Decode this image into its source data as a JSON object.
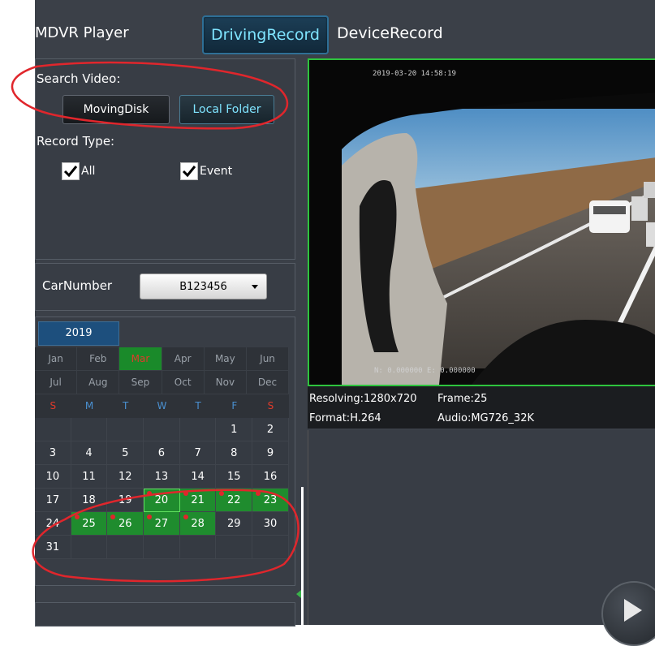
{
  "app": {
    "title": "MDVR Player",
    "tabs": [
      {
        "label": "DrivingRecord",
        "active": true
      },
      {
        "label": "DeviceRecord",
        "active": false
      }
    ]
  },
  "search": {
    "label": "Search Video:",
    "moving_disk": "MovingDisk",
    "local_folder": "Local Folder"
  },
  "record_type": {
    "label": "Record Type:",
    "options": [
      {
        "label": "All",
        "checked": true
      },
      {
        "label": "Event",
        "checked": true
      }
    ]
  },
  "car": {
    "label": "CarNumber",
    "selected": "B123456"
  },
  "calendar": {
    "year": "2019",
    "months": [
      "Jan",
      "Feb",
      "Mar",
      "Apr",
      "May",
      "Jun",
      "Jul",
      "Aug",
      "Sep",
      "Oct",
      "Nov",
      "Dec"
    ],
    "active_month": "Mar",
    "weekdays": [
      "S",
      "M",
      "T",
      "W",
      "T",
      "F",
      "S"
    ],
    "days": [
      [
        "",
        "",
        "",
        "",
        "",
        "1",
        "2"
      ],
      [
        "3",
        "4",
        "5",
        "6",
        "7",
        "8",
        "9"
      ],
      [
        "10",
        "11",
        "12",
        "13",
        "14",
        "15",
        "16"
      ],
      [
        "17",
        "18",
        "19",
        "20",
        "21",
        "22",
        "23"
      ],
      [
        "24",
        "25",
        "26",
        "27",
        "28",
        "29",
        "30"
      ],
      [
        "31",
        "",
        "",
        "",
        "",
        "",
        ""
      ]
    ],
    "recorded_days": [
      "20",
      "21",
      "22",
      "23",
      "25",
      "26",
      "27",
      "28"
    ],
    "selected_day": "20"
  },
  "video": {
    "osd_timestamp": "2019-03-20 14:58:19",
    "osd_gps": "N:  0.000000 E:  0.000000",
    "resolution": "Resolving:1280x720",
    "frame": "Frame:25",
    "format": "Format:H.264",
    "audio": "Audio:MG726_32K"
  },
  "colors": {
    "accent": "#7fe4ff",
    "record_green": "#1f8c2e",
    "video_border": "#2ec43e",
    "annotation_red": "#e0262c"
  }
}
